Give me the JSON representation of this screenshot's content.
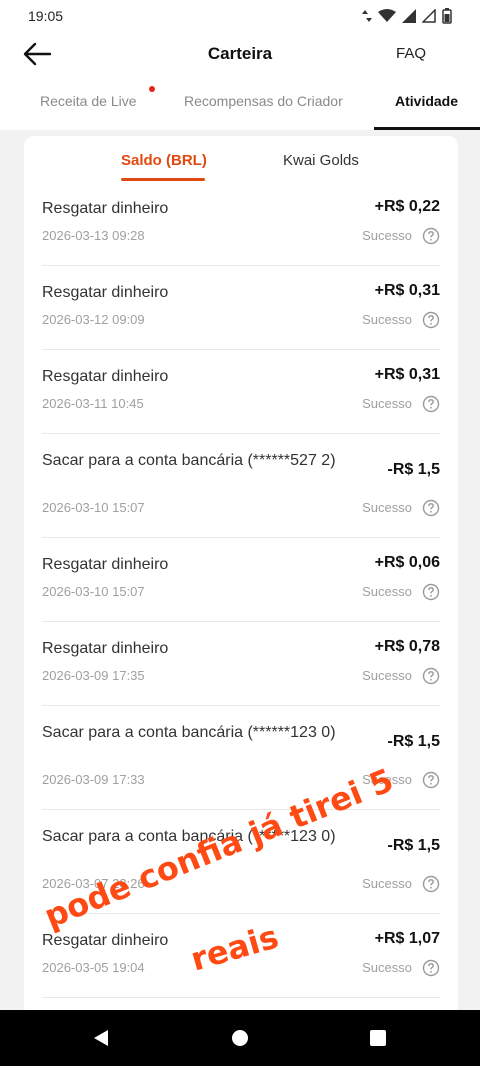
{
  "status_bar": {
    "time": "19:05"
  },
  "header": {
    "title": "Carteira",
    "faq": "FAQ"
  },
  "top_tabs": [
    {
      "label": "Receita de Live"
    },
    {
      "label": "Recompensas do Criador"
    },
    {
      "label": "Atividade"
    }
  ],
  "sub_tabs": [
    {
      "label": "Saldo (BRL)"
    },
    {
      "label": "Kwai Golds"
    }
  ],
  "transactions": [
    {
      "title": "Resgatar dinheiro",
      "amount": "+R$ 0,22",
      "date": "2026-03-13 09:28",
      "status": "Sucesso"
    },
    {
      "title": "Resgatar dinheiro",
      "amount": "+R$ 0,31",
      "date": "2026-03-12 09:09",
      "status": "Sucesso"
    },
    {
      "title": "Resgatar dinheiro",
      "amount": "+R$ 0,31",
      "date": "2026-03-11 10:45",
      "status": "Sucesso"
    },
    {
      "title": "Sacar para a conta bancária (******527 2)",
      "amount": "-R$ 1,5",
      "date": "2026-03-10 15:07",
      "status": "Sucesso"
    },
    {
      "title": "Resgatar dinheiro",
      "amount": "+R$ 0,06",
      "date": "2026-03-10 15:07",
      "status": "Sucesso"
    },
    {
      "title": "Resgatar dinheiro",
      "amount": "+R$ 0,78",
      "date": "2026-03-09 17:35",
      "status": "Sucesso"
    },
    {
      "title": "Sacar para a conta bancária (******123 0)",
      "amount": "-R$ 1,5",
      "date": "2026-03-09 17:33",
      "status": "Sucesso"
    },
    {
      "title": "Sacar para a conta bancária (******123 0)",
      "amount": "-R$ 1,5",
      "date": "2026-03-07 23:26",
      "status": "Sucesso"
    },
    {
      "title": "Resgatar dinheiro",
      "amount": "+R$ 1,07",
      "date": "2026-03-05 19:04",
      "status": "Sucesso"
    }
  ],
  "overlay": {
    "line1": "pode confia já tirei 5",
    "line2": "reais"
  },
  "colors": {
    "accent": "#e04a10",
    "overlay": "#ff4a14",
    "notification_dot": "#e0251b"
  }
}
